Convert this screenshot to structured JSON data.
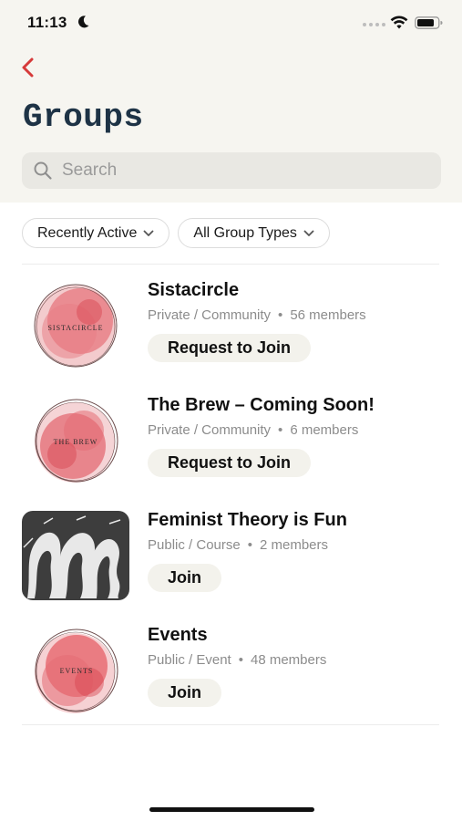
{
  "status": {
    "time": "11:13"
  },
  "header": {
    "title": "Groups"
  },
  "search": {
    "placeholder": "Search"
  },
  "filters": [
    {
      "label": "Recently Active"
    },
    {
      "label": "All Group Types"
    }
  ],
  "groups": [
    {
      "name": "Sistacircle",
      "type": "Private / Community",
      "members": "56 members",
      "action": "Request to Join",
      "logo_text": "SISTACIRCLE"
    },
    {
      "name": "The Brew – Coming Soon!",
      "type": "Private / Community",
      "members": "6 members",
      "action": "Request to Join",
      "logo_text": "THE BREW"
    },
    {
      "name": "Feminist Theory is Fun",
      "type": "Public / Course",
      "members": "2 members",
      "action": "Join"
    },
    {
      "name": "Events",
      "type": "Public / Event",
      "members": "48 members",
      "action": "Join",
      "logo_text": "EVENTS"
    }
  ],
  "meta_separator": "•",
  "colors": {
    "accent": "#d63a3a",
    "title": "#1e3346",
    "logo_red": "#e0505a"
  }
}
